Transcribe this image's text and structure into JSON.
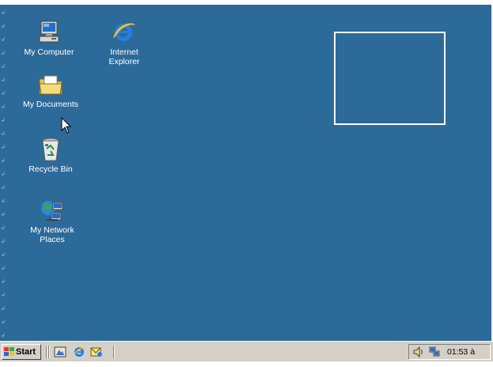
{
  "desktop": {
    "background_color": "#2c6a9a",
    "icons": [
      {
        "label": "My Computer",
        "icon": "my-computer-icon"
      },
      {
        "label": "Internet\nExplorer",
        "icon": "internet-explorer-icon"
      },
      {
        "label": "My Documents",
        "icon": "my-documents-icon"
      },
      {
        "label": "Recycle Bin",
        "icon": "recycle-bin-icon"
      },
      {
        "label": "My Network\nPlaces",
        "icon": "my-network-places-icon"
      }
    ]
  },
  "taskbar": {
    "start_label": "Start",
    "quick_launch": [
      {
        "icon": "show-desktop-icon"
      },
      {
        "icon": "internet-explorer-icon"
      },
      {
        "icon": "outlook-express-icon"
      }
    ],
    "tray": {
      "icons": [
        "volume-icon",
        "network-icon"
      ],
      "clock": "01:53 à"
    }
  }
}
